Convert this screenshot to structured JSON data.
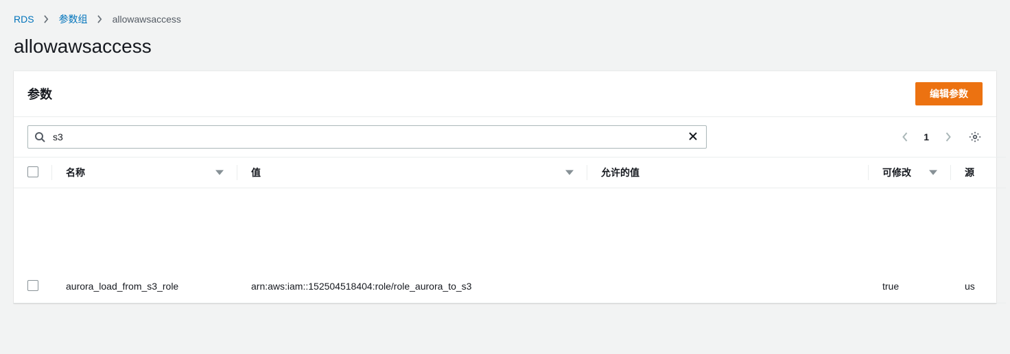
{
  "breadcrumb": {
    "root": "RDS",
    "group": "参数组",
    "current": "allowawsaccess"
  },
  "page": {
    "title": "allowawsaccess"
  },
  "panel": {
    "title": "参数",
    "edit_button": "编辑参数"
  },
  "search": {
    "value": "s3"
  },
  "pager": {
    "page": "1"
  },
  "table": {
    "headers": {
      "name": "名称",
      "value": "值",
      "allowed": "允许的值",
      "modifiable": "可修改",
      "source": "源"
    },
    "rows": [
      {
        "name": "aurora_load_from_s3_role",
        "value": "arn:aws:iam::152504518404:role/role_aurora_to_s3",
        "allowed": "",
        "modifiable": "true",
        "source": "us"
      }
    ]
  }
}
